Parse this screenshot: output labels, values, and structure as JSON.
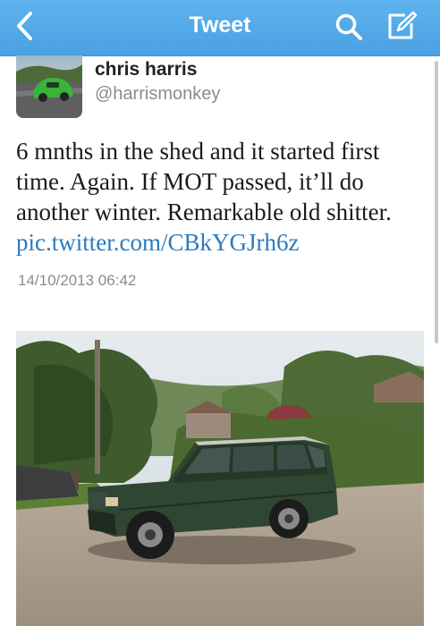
{
  "nav": {
    "title": "Tweet",
    "back_icon": "chevron-left-icon",
    "search_icon": "search-icon",
    "compose_icon": "compose-icon",
    "bar_color": "#55aaea"
  },
  "tweet": {
    "name": "chris harris",
    "handle": "@harrismonkey",
    "text": "6 mnths in the shed and it started first time. Again. If MOT passed, it’ll do another winter. Remarkable old shitter. ",
    "link": "pic.twitter.com/CBkYGJrh6z",
    "timestamp": "14/10/2013 06:42",
    "link_color": "#2b7bbf"
  }
}
